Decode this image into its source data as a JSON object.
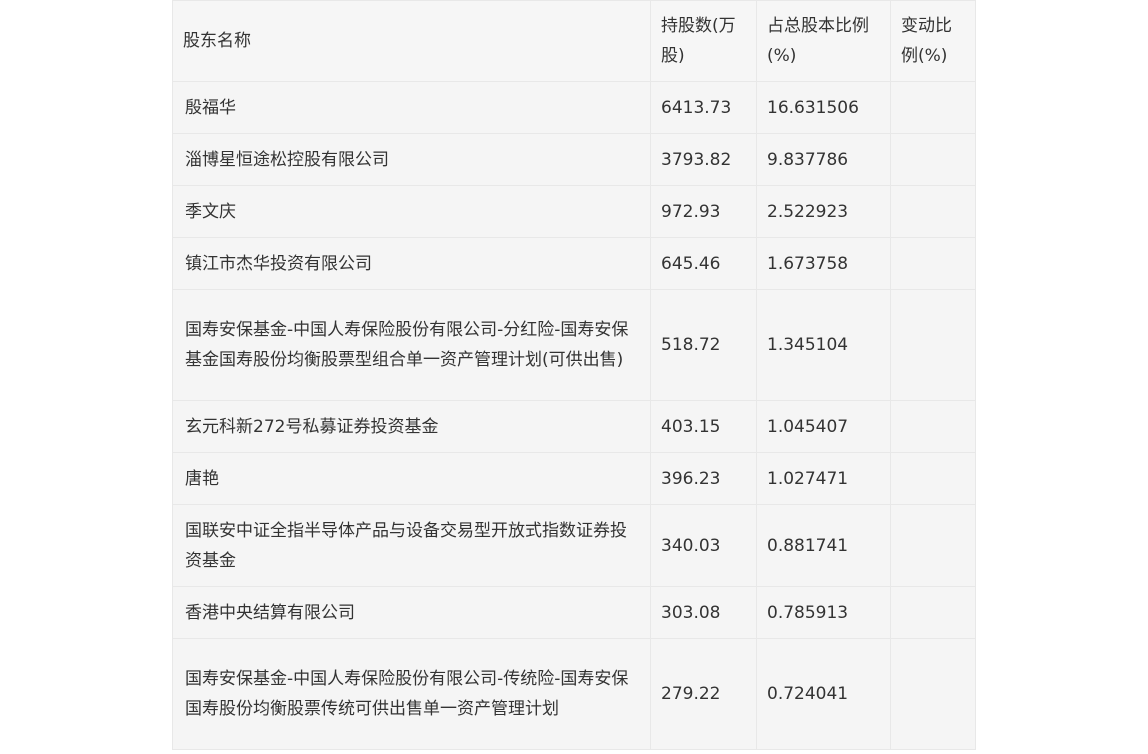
{
  "table": {
    "headers": {
      "name": "股东名称",
      "shares": "持股数(万股)",
      "ratio": "占总股本比例(%)",
      "change": "变动比例(%)"
    },
    "rows": [
      {
        "name": "殷福华",
        "shares": "6413.73",
        "ratio": "16.631506",
        "change": ""
      },
      {
        "name": "淄博星恒途松控股有限公司",
        "shares": "3793.82",
        "ratio": "9.837786",
        "change": ""
      },
      {
        "name": "季文庆",
        "shares": "972.93",
        "ratio": "2.522923",
        "change": ""
      },
      {
        "name": "镇江市杰华投资有限公司",
        "shares": "645.46",
        "ratio": "1.673758",
        "change": ""
      },
      {
        "name": "国寿安保基金-中国人寿保险股份有限公司-分红险-国寿安保基金国寿股份均衡股票型组合单一资产管理计划(可供出售)",
        "shares": "518.72",
        "ratio": "1.345104",
        "change": ""
      },
      {
        "name": "玄元科新272号私募证券投资基金",
        "shares": "403.15",
        "ratio": "1.045407",
        "change": ""
      },
      {
        "name": "唐艳",
        "shares": "396.23",
        "ratio": "1.027471",
        "change": ""
      },
      {
        "name": "国联安中证全指半导体产品与设备交易型开放式指数证券投资基金",
        "shares": "340.03",
        "ratio": "0.881741",
        "change": ""
      },
      {
        "name": "香港中央结算有限公司",
        "shares": "303.08",
        "ratio": "0.785913",
        "change": ""
      },
      {
        "name": "国寿安保基金-中国人寿保险股份有限公司-传统险-国寿安保国寿股份均衡股票传统可供出售单一资产管理计划",
        "shares": "279.22",
        "ratio": "0.724041",
        "change": ""
      }
    ]
  }
}
